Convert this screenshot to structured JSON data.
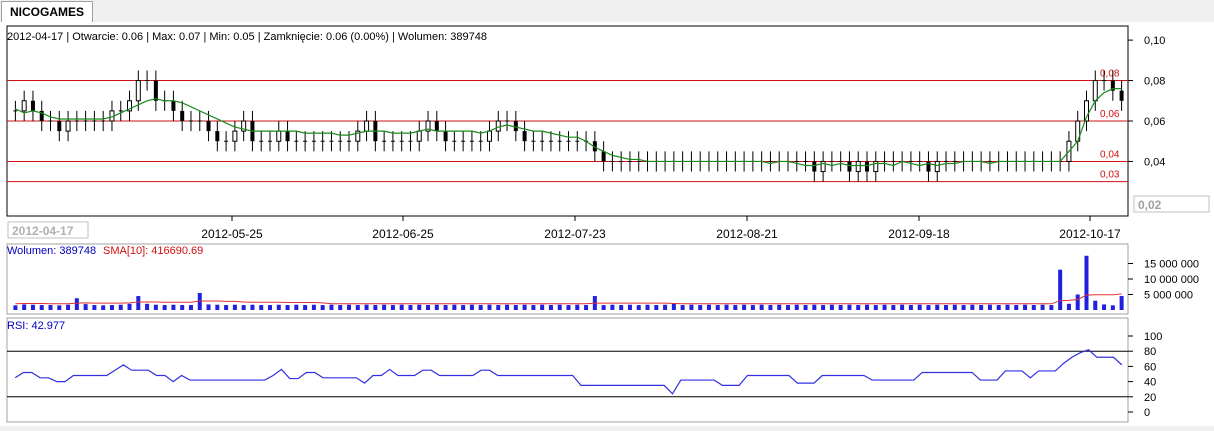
{
  "tab": {
    "label": "NICOGAMES"
  },
  "price_info": "2012-04-17 | Otwarcie: 0.06 | Max: 0.07 | Min: 0.05 | Zamknięcie: 0.06 (0.00%)  | Wolumen: 389748",
  "volume_info": {
    "label": "Wolumen: 389748",
    "sma": "SMA[10]: 416690.69"
  },
  "rsi_info": "RSI: 42.977",
  "date_cursor": "2012-04-17",
  "price_cursor": "0,02",
  "colors": {
    "candle": "#000000",
    "sma_price": "#1a8a1a",
    "level": "#d01010",
    "volume": "#2020e0",
    "sma_volume": "#e03030",
    "rsi": "#3030e0"
  },
  "chart_data": {
    "type": "candlestick",
    "x_ticks": [
      "2012-05-25",
      "2012-06-25",
      "2012-07-23",
      "2012-08-21",
      "2012-09-18",
      "2012-10-17"
    ],
    "price": {
      "ylim": [
        0.015,
        0.105
      ],
      "y_ticks": [
        "0,10",
        "0,08",
        "0,06",
        "0,04"
      ],
      "levels": [
        {
          "value": 0.08,
          "label": "0,08"
        },
        {
          "value": 0.06,
          "label": "0,06"
        },
        {
          "value": 0.04,
          "label": "0,04"
        },
        {
          "value": 0.03,
          "label": "0,03"
        }
      ],
      "close": [
        0.065,
        0.07,
        0.065,
        0.06,
        0.06,
        0.055,
        0.06,
        0.06,
        0.06,
        0.06,
        0.06,
        0.065,
        0.065,
        0.07,
        0.08,
        0.08,
        0.07,
        0.07,
        0.065,
        0.06,
        0.06,
        0.06,
        0.055,
        0.05,
        0.05,
        0.055,
        0.06,
        0.05,
        0.05,
        0.05,
        0.055,
        0.05,
        0.05,
        0.05,
        0.05,
        0.05,
        0.05,
        0.05,
        0.05,
        0.055,
        0.06,
        0.05,
        0.05,
        0.05,
        0.05,
        0.05,
        0.055,
        0.06,
        0.055,
        0.05,
        0.05,
        0.05,
        0.05,
        0.05,
        0.055,
        0.06,
        0.06,
        0.055,
        0.05,
        0.05,
        0.05,
        0.05,
        0.05,
        0.05,
        0.05,
        0.05,
        0.045,
        0.04,
        0.04,
        0.04,
        0.04,
        0.04,
        0.04,
        0.04,
        0.04,
        0.04,
        0.04,
        0.04,
        0.04,
        0.04,
        0.04,
        0.04,
        0.04,
        0.04,
        0.04,
        0.04,
        0.04,
        0.04,
        0.04,
        0.04,
        0.04,
        0.035,
        0.04,
        0.04,
        0.04,
        0.035,
        0.04,
        0.035,
        0.04,
        0.04,
        0.04,
        0.04,
        0.04,
        0.04,
        0.035,
        0.04,
        0.04,
        0.04,
        0.04,
        0.04,
        0.04,
        0.04,
        0.04,
        0.04,
        0.04,
        0.04,
        0.04,
        0.04,
        0.04,
        0.04,
        0.05,
        0.06,
        0.07,
        0.08,
        0.08,
        0.075,
        0.07
      ],
      "sma10": [
        0.066,
        0.064,
        0.065,
        0.064,
        0.062,
        0.061,
        0.061,
        0.061,
        0.061,
        0.061,
        0.061,
        0.062,
        0.064,
        0.066,
        0.068,
        0.07,
        0.071,
        0.07,
        0.07,
        0.069,
        0.067,
        0.065,
        0.063,
        0.061,
        0.059,
        0.057,
        0.056,
        0.055,
        0.055,
        0.055,
        0.055,
        0.055,
        0.055,
        0.054,
        0.054,
        0.054,
        0.054,
        0.053,
        0.053,
        0.054,
        0.055,
        0.055,
        0.055,
        0.054,
        0.054,
        0.054,
        0.055,
        0.056,
        0.055,
        0.055,
        0.055,
        0.055,
        0.055,
        0.054,
        0.055,
        0.057,
        0.058,
        0.057,
        0.056,
        0.055,
        0.055,
        0.054,
        0.053,
        0.052,
        0.052,
        0.05,
        0.047,
        0.045,
        0.043,
        0.042,
        0.041,
        0.041,
        0.04,
        0.04,
        0.04,
        0.04,
        0.04,
        0.04,
        0.04,
        0.04,
        0.04,
        0.04,
        0.04,
        0.04,
        0.04,
        0.04,
        0.039,
        0.04,
        0.04,
        0.039,
        0.038,
        0.038,
        0.039,
        0.038,
        0.039,
        0.038,
        0.038,
        0.038,
        0.039,
        0.039,
        0.038,
        0.04,
        0.039,
        0.038,
        0.039,
        0.038,
        0.039,
        0.039,
        0.04,
        0.04,
        0.04,
        0.039,
        0.04,
        0.04,
        0.04,
        0.04,
        0.04,
        0.04,
        0.04,
        0.04,
        0.045,
        0.05,
        0.062,
        0.07,
        0.074,
        0.076,
        0.076
      ]
    },
    "volume": {
      "ylim": [
        0,
        20000000
      ],
      "y_ticks": [
        "15 000 000",
        "10 000 000",
        "5 000 000"
      ],
      "values": [
        1500000,
        1800000,
        1700000,
        1600000,
        1600000,
        1500000,
        1700000,
        3800000,
        1900000,
        1600000,
        1500000,
        1600000,
        1700000,
        2000000,
        4500000,
        2000000,
        1700000,
        1600000,
        1700000,
        1600000,
        1600000,
        5500000,
        1800000,
        1700000,
        1600000,
        1700000,
        1600000,
        1700000,
        1600000,
        1600000,
        1700000,
        1600000,
        1700000,
        1600000,
        1700000,
        1600000,
        1700000,
        1600000,
        1700000,
        1600000,
        1700000,
        1600000,
        1700000,
        1600000,
        1700000,
        1600000,
        1700000,
        1600000,
        1700000,
        1600000,
        1700000,
        1600000,
        1700000,
        1600000,
        1700000,
        1600000,
        1700000,
        1600000,
        1700000,
        1600000,
        1700000,
        1600000,
        1700000,
        1600000,
        1700000,
        1600000,
        4500000,
        1600000,
        1700000,
        1600000,
        1700000,
        1600000,
        1700000,
        1600000,
        1700000,
        2000000,
        1600000,
        1700000,
        1600000,
        1700000,
        1600000,
        1700000,
        1600000,
        1700000,
        1600000,
        1700000,
        1600000,
        1700000,
        1600000,
        1700000,
        1600000,
        1700000,
        1600000,
        1700000,
        1600000,
        1700000,
        1600000,
        1700000,
        1600000,
        1700000,
        1600000,
        1700000,
        1600000,
        1700000,
        1600000,
        1700000,
        1600000,
        1700000,
        1600000,
        1700000,
        1600000,
        1700000,
        1600000,
        1700000,
        1600000,
        1700000,
        1600000,
        1700000,
        1600000,
        13000000,
        2000000,
        5000000,
        17500000,
        3000000,
        1800000,
        1500000,
        4500000
      ],
      "sma10": [
        2000000,
        2100000,
        2100000,
        2100000,
        2000000,
        2000000,
        2000000,
        2200000,
        2300000,
        2200000,
        2200000,
        2200000,
        2200000,
        2300000,
        2600000,
        2600000,
        2600000,
        2500000,
        2500000,
        2500000,
        2500000,
        2900000,
        2900000,
        2900000,
        2800000,
        2800000,
        2600000,
        2500000,
        2500000,
        2500000,
        2500000,
        2400000,
        2400000,
        2400000,
        2400000,
        2300000,
        2000000,
        2000000,
        2000000,
        2000000,
        2000000,
        2000000,
        2000000,
        2000000,
        2000000,
        2000000,
        2000000,
        2000000,
        2000000,
        2000000,
        2000000,
        2000000,
        2000000,
        2000000,
        2000000,
        2000000,
        2000000,
        2000000,
        2000000,
        2000000,
        2000000,
        2000000,
        2000000,
        2000000,
        2000000,
        2000000,
        2200000,
        2200000,
        2200000,
        2200000,
        2200000,
        2200000,
        2200000,
        2200000,
        2200000,
        2100000,
        2000000,
        2000000,
        2000000,
        2000000,
        2000000,
        2000000,
        2000000,
        2000000,
        2000000,
        2000000,
        2000000,
        2000000,
        2000000,
        2000000,
        2000000,
        2000000,
        2000000,
        2000000,
        2000000,
        2000000,
        2000000,
        2000000,
        2000000,
        2000000,
        2000000,
        2000000,
        2000000,
        2000000,
        2000000,
        2000000,
        2000000,
        2000000,
        2000000,
        2000000,
        2000000,
        2000000,
        2000000,
        2000000,
        2000000,
        2000000,
        2000000,
        2000000,
        2000000,
        3000000,
        3100000,
        3400000,
        4800000,
        4900000,
        4900000,
        4900000,
        5200000
      ]
    },
    "rsi": {
      "ylim": [
        0,
        100
      ],
      "y_ticks": [
        "100",
        "80",
        "60",
        "40",
        "20",
        "0"
      ],
      "levels": [
        80,
        20
      ],
      "values": [
        45,
        52,
        52,
        45,
        45,
        40,
        40,
        48,
        48,
        48,
        48,
        48,
        55,
        62,
        55,
        55,
        55,
        48,
        48,
        40,
        48,
        42,
        42,
        42,
        42,
        42,
        42,
        42,
        42,
        42,
        42,
        48,
        56,
        44,
        44,
        52,
        52,
        45,
        45,
        45,
        45,
        45,
        38,
        48,
        48,
        56,
        48,
        48,
        48,
        55,
        55,
        48,
        48,
        48,
        48,
        48,
        55,
        55,
        48,
        48,
        48,
        48,
        48,
        48,
        48,
        48,
        48,
        48,
        35,
        35,
        35,
        35,
        35,
        35,
        35,
        35,
        35,
        35,
        35,
        24,
        42,
        42,
        42,
        42,
        42,
        35,
        35,
        35,
        48,
        48,
        48,
        48,
        48,
        48,
        38,
        38,
        38,
        48,
        48,
        48,
        48,
        48,
        48,
        42,
        42,
        42,
        42,
        42,
        42,
        52,
        52,
        52,
        52,
        52,
        52,
        52,
        42,
        42,
        42,
        54,
        54,
        54,
        45,
        54,
        54,
        54,
        64,
        72,
        78,
        82,
        72,
        72,
        72,
        62
      ]
    }
  }
}
